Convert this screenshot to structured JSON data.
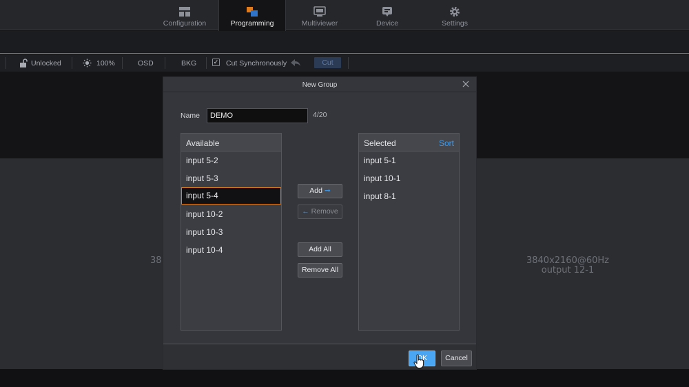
{
  "nav": {
    "tabs": [
      {
        "label": "Configuration",
        "icon": "layout-grid-icon",
        "active": false
      },
      {
        "label": "Programming",
        "icon": "programming-icon",
        "active": true
      },
      {
        "label": "Multiviewer",
        "icon": "monitor-icon",
        "active": false
      },
      {
        "label": "Device",
        "icon": "device-icon",
        "active": false
      },
      {
        "label": "Settings",
        "icon": "gear-icon",
        "active": false
      }
    ]
  },
  "toolbar": {
    "lock_label": "Unlocked",
    "brightness_label": "100%",
    "osd_label": "OSD",
    "bkg_label": "BKG",
    "cut_sync_label": "Cut Synchronously",
    "cut_sync_checked": true,
    "cut_label": "Cut"
  },
  "background": {
    "left_ghost_text": "38",
    "right_ghost_line1": "3840x2160@60Hz",
    "right_ghost_line2": "output 12-1"
  },
  "dialog": {
    "title": "New Group",
    "name_label": "Name",
    "name_value": "DEMO",
    "name_count": "4/20",
    "available_title": "Available",
    "available_items": [
      "input 5-2",
      "input 5-3",
      "input 5-4",
      "input 10-2",
      "input 10-3",
      "input 10-4"
    ],
    "available_selected_index": 2,
    "selected_title": "Selected",
    "sort_label": "Sort",
    "selected_items": [
      "input 5-1",
      "input 10-1",
      "input 8-1"
    ],
    "add_label": "Add",
    "remove_label": "Remove",
    "add_all_label": "Add All",
    "remove_all_label": "Remove All",
    "ok_label": "OK",
    "cancel_label": "Cancel"
  },
  "colors": {
    "accent": "#3b9bef",
    "selection_border": "#e07c1c",
    "status_green": "#2fa84a"
  }
}
